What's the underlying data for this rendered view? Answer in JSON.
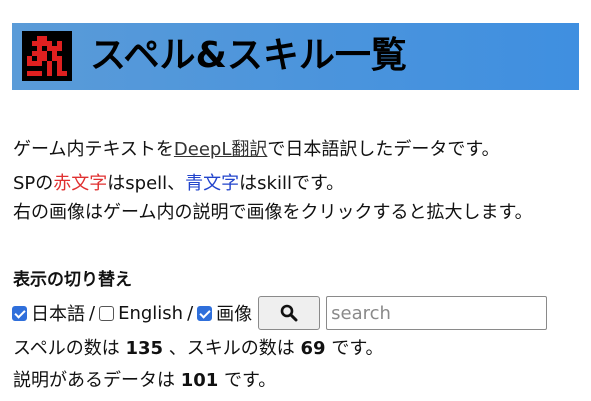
{
  "header": {
    "title": "スペル&スキル一覧",
    "banner_color": "#4a98e0",
    "logo_icon": "pixel-character-icon",
    "logo_colors": [
      "#000000",
      "#e02020"
    ]
  },
  "intro": {
    "line1_link": "DeepL翻訳",
    "line1_prefix": "ゲーム内テキストを",
    "line1_suffix": "で日本語訳したデータです。",
    "line2_prefix": "SPの",
    "line2_red": "赤文字",
    "line2_mid1": "はspell、",
    "line2_blue": "青文字",
    "line2_mid2": "はskillです。",
    "line3": "右の画像はゲーム内の説明で画像をクリックすると拡大します。",
    "red_color": "#e03030",
    "blue_color": "#2244cc"
  },
  "toggle": {
    "title": "表示の切り替え",
    "options": [
      {
        "label": "日本語",
        "checked": true
      },
      {
        "label": "English",
        "checked": false
      },
      {
        "label": "画像",
        "checked": true
      }
    ],
    "separator": "/",
    "search_button_icon": "magnifier-icon",
    "search_placeholder": "search"
  },
  "stats": {
    "spell_prefix": "スペルの数は",
    "spell_count": "135",
    "skill_prefix": "、スキルの数は",
    "skill_count": "69",
    "suffix1": "です。",
    "desc_prefix": "説明があるデータは",
    "desc_count": "101",
    "suffix2": "です。"
  }
}
